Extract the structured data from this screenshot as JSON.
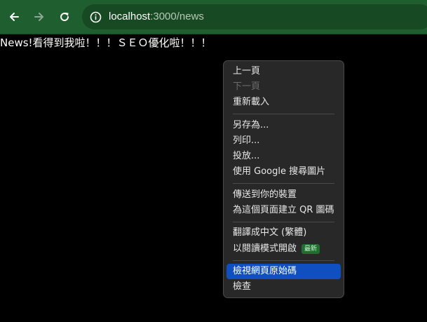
{
  "browser": {
    "url_host": "localhost",
    "url_path": ":3000/news",
    "toolbar_color": "#1f5e2e"
  },
  "page": {
    "heading": "News!看得到我啦！！！ＳＥＯ優化啦！！！"
  },
  "context_menu": {
    "items": [
      {
        "label": "上一頁",
        "disabled": false
      },
      {
        "label": "下一頁",
        "disabled": true
      },
      {
        "label": "重新載入",
        "disabled": false
      },
      {
        "label": "另存為...",
        "disabled": false
      },
      {
        "label": "列印...",
        "disabled": false
      },
      {
        "label": "投放...",
        "disabled": false
      },
      {
        "label": "使用 Google 搜尋圖片",
        "disabled": false
      },
      {
        "label": "傳送到你的裝置",
        "disabled": false
      },
      {
        "label": "為這個頁面建立 QR 圖碼",
        "disabled": false
      },
      {
        "label": "翻譯成中文 (繁體)",
        "disabled": false
      },
      {
        "label": "以閱讀模式開啟",
        "disabled": false,
        "badge": "最新"
      },
      {
        "label": "檢視網頁原始碼",
        "disabled": false,
        "highlighted": true
      },
      {
        "label": "檢查",
        "disabled": false
      }
    ]
  }
}
